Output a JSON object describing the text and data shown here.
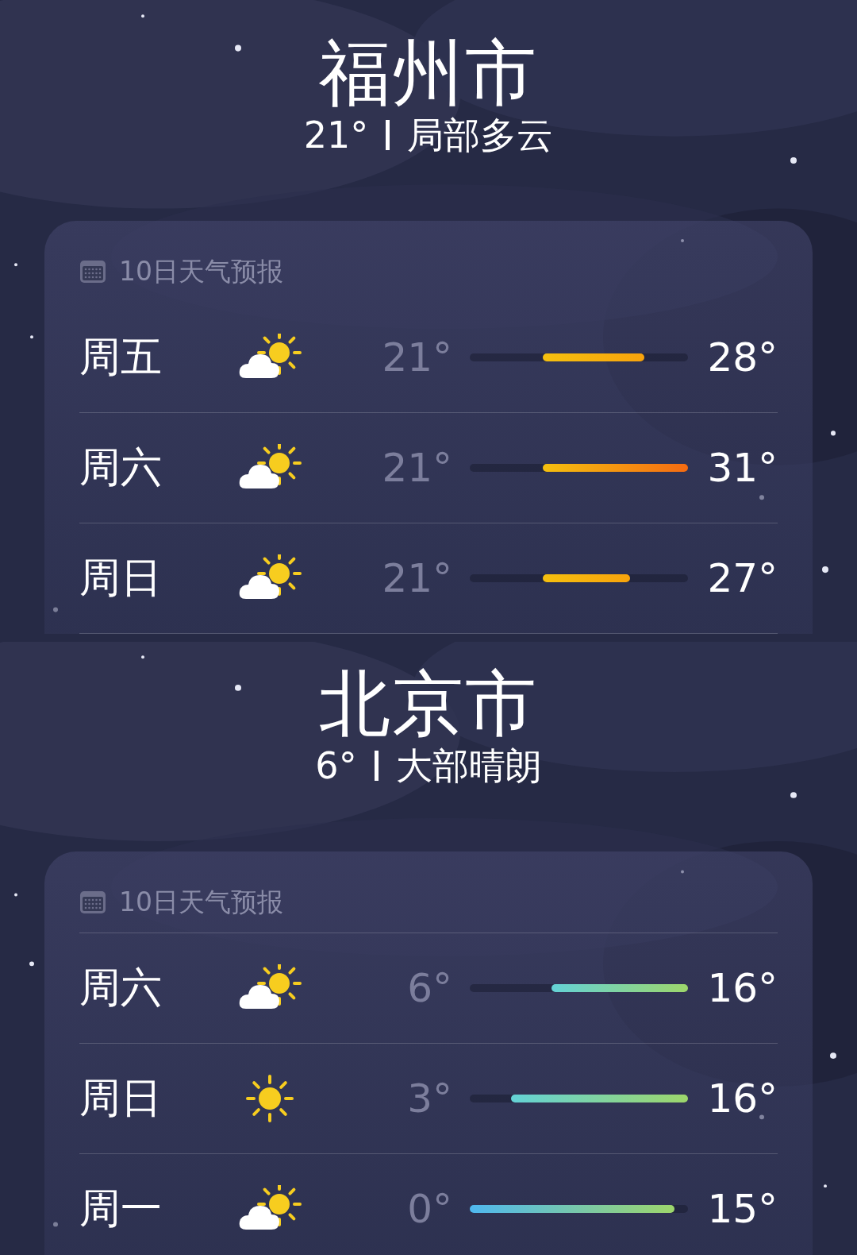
{
  "panels": [
    {
      "city": "福州市",
      "temperature": "21°",
      "condition": "局部多云",
      "forecast_title": "10日天气预报",
      "days": [
        {
          "day": "周五",
          "kind": "partly_cloudy",
          "low": "21°",
          "high": "28°"
        },
        {
          "day": "周六",
          "kind": "partly_cloudy",
          "low": "21°",
          "high": "31°"
        },
        {
          "day": "周日",
          "kind": "partly_cloudy",
          "low": "21°",
          "high": "27°"
        }
      ]
    },
    {
      "city": "北京市",
      "temperature": "6°",
      "condition": "大部晴朗",
      "forecast_title": "10日天气预报",
      "days": [
        {
          "day": "周六",
          "kind": "partly_cloudy",
          "low": "6°",
          "high": "16°"
        },
        {
          "day": "周日",
          "kind": "sunny",
          "low": "3°",
          "high": "16°"
        },
        {
          "day": "周一",
          "kind": "partly_cloudy",
          "low": "0°",
          "high": "15°"
        }
      ]
    }
  ]
}
